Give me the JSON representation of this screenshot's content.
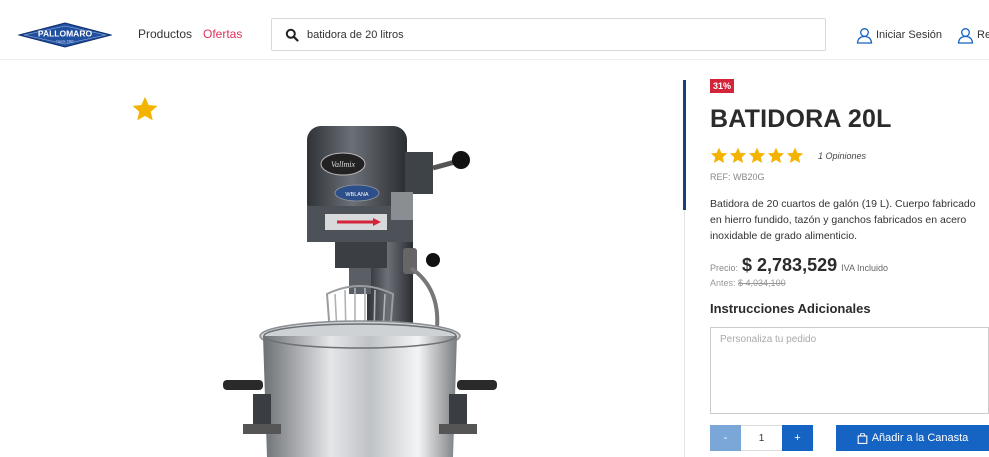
{
  "header": {
    "logo_text": "PALLOMARO",
    "logo_subtext": "Desde 1960",
    "nav": {
      "productos": "Productos",
      "ofertas": "Ofertas"
    },
    "search": {
      "value": "batidora de 20 litros",
      "icon": "search-icon"
    },
    "account": {
      "login": "Iniciar Sesión",
      "register": "Re"
    }
  },
  "product": {
    "discount_badge": "31%",
    "title": "BATIDORA 20L",
    "rating": 5,
    "reviews": "1 Opiniones",
    "ref": "REF: WB20G",
    "description": "Batidora de 20 cuartos de galón (19 L). Cuerpo fabricado en hierro fundido, tazón y ganchos fabricados en acero inoxidable de grado alimenticio.",
    "price_label": "Precio:",
    "price": "$ 2,783,529",
    "iva": "IVA Incluido",
    "before_label": "Antes:",
    "before_price": "$ 4,034,100",
    "machine_label": "Vallmix",
    "machine_plate": "WBLANA"
  },
  "order": {
    "instructions_title": "Instrucciones Adicionales",
    "notes_placeholder": "Personaliza tu pedido",
    "qty_minus": "-",
    "qty_plus": "+",
    "quantity": "1",
    "add_to_cart": "Añadir a la Canasta"
  },
  "colors": {
    "brand_blue": "#1563c2",
    "navy": "#1c3f7a",
    "offer_pink": "#e0315a",
    "badge_red": "#d4243a",
    "star_yellow": "#f5b301"
  }
}
